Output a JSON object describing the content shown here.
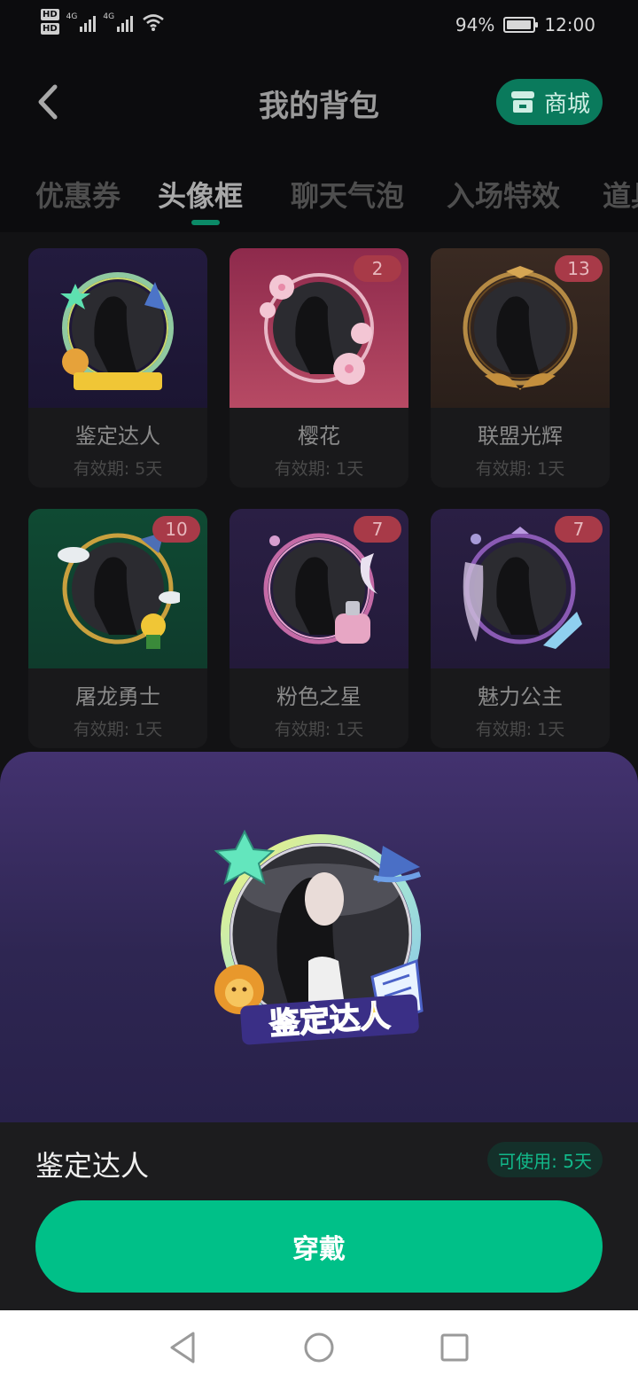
{
  "status_bar": {
    "hd1": "HD",
    "hd2": "HD",
    "net1": "4G",
    "net2": "4G",
    "battery_percent": "94%",
    "time": "12:00"
  },
  "header": {
    "title": "我的背包",
    "mall_label": "商城"
  },
  "tabs": [
    "优惠券",
    "头像框",
    "聊天气泡",
    "入场特效",
    "道具"
  ],
  "active_tab": 1,
  "frames": [
    {
      "name": "鉴定达人",
      "validity": "有效期: 5天",
      "count": "",
      "theme": "star-wizard"
    },
    {
      "name": "樱花",
      "validity": "有效期: 1天",
      "count": "2",
      "theme": "sakura"
    },
    {
      "name": "联盟光辉",
      "validity": "有效期: 1天",
      "count": "13",
      "theme": "league"
    },
    {
      "name": "屠龙勇士",
      "validity": "有效期: 1天",
      "count": "10",
      "theme": "dragon"
    },
    {
      "name": "粉色之星",
      "validity": "有效期: 1天",
      "count": "7",
      "theme": "pink-star"
    },
    {
      "name": "魅力公主",
      "validity": "有效期: 1天",
      "count": "7",
      "theme": "princess"
    }
  ],
  "preview": {
    "frame_text": "鉴定达人"
  },
  "selected": {
    "name": "鉴定达人",
    "usable": "可使用: 5天",
    "action_label": "穿戴"
  },
  "colors": {
    "accent": "#00c088",
    "badge": "#a83a48",
    "sheet_top": "#43326f"
  }
}
